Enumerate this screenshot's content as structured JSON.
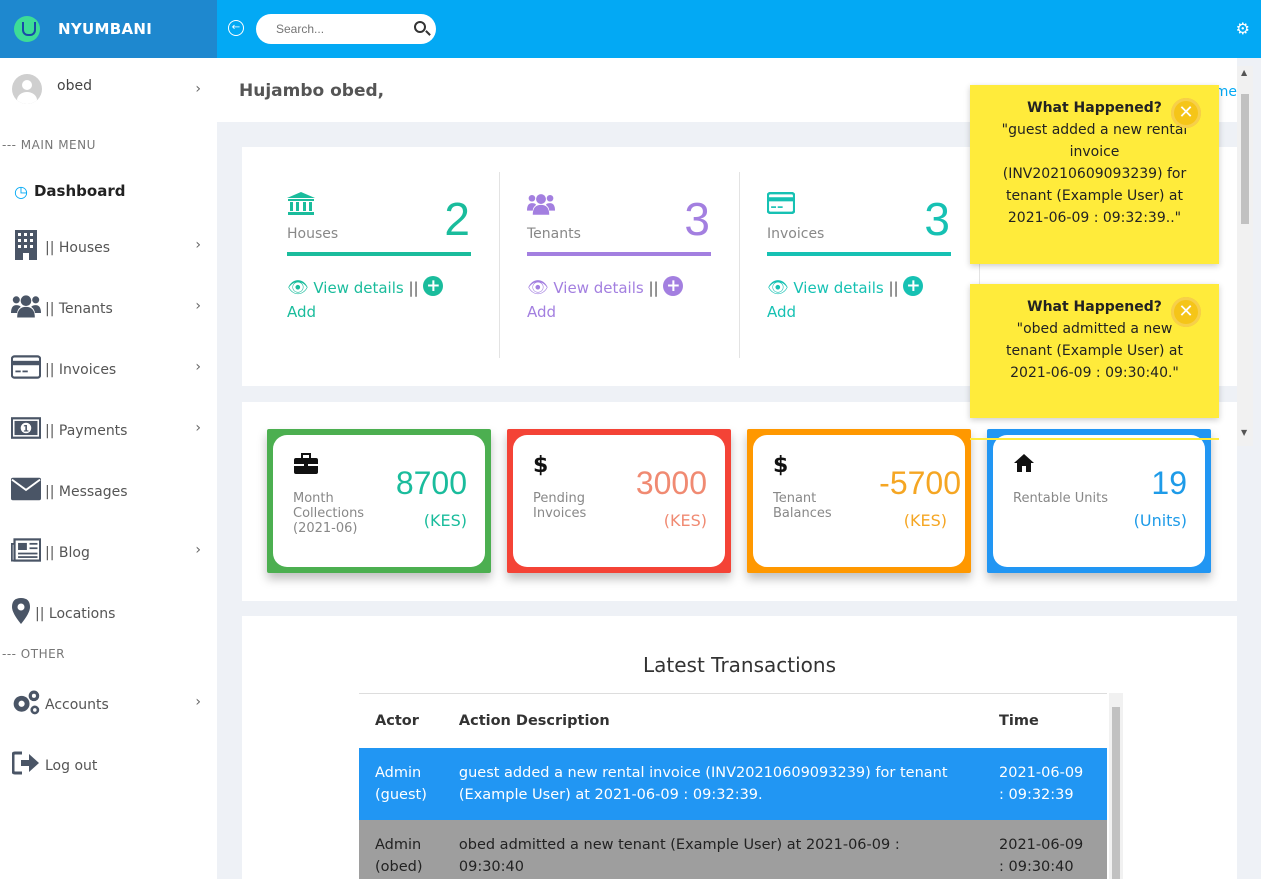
{
  "brand": {
    "name": "NYUMBANI"
  },
  "user": {
    "name": "obed"
  },
  "sidebar": {
    "main_menu_label": "--- MAIN MENU",
    "other_label": "--- OTHER",
    "dashboard": "Dashboard",
    "items": [
      {
        "label": "|| Houses",
        "icon": "building-icon"
      },
      {
        "label": "|| Tenants",
        "icon": "users-icon"
      },
      {
        "label": "|| Invoices",
        "icon": "credit-card-icon"
      },
      {
        "label": "|| Payments",
        "icon": "money-bill-icon"
      },
      {
        "label": "|| Messages",
        "icon": "envelope-icon"
      },
      {
        "label": "|| Blog",
        "icon": "newspaper-icon"
      },
      {
        "label": "|| Locations",
        "icon": "map-marker-icon"
      }
    ],
    "other_items": [
      {
        "label": "Accounts",
        "icon": "cogs-icon"
      },
      {
        "label": "Log out",
        "icon": "sign-out-icon"
      }
    ]
  },
  "topbar": {
    "search_placeholder": "Search..."
  },
  "greeting": {
    "text": "Hujambo obed,",
    "home_link": "me"
  },
  "stats": [
    {
      "label": "Houses",
      "value": "2",
      "color": "#1abc9c",
      "view": "View details",
      "sep": " || ",
      "add": "Add",
      "icon": "bank-icon"
    },
    {
      "label": "Tenants",
      "value": "3",
      "color": "#a37fe0",
      "view": "View details",
      "sep": " || ",
      "add": "Add",
      "icon": "users-icon"
    },
    {
      "label": "Invoices",
      "value": "3",
      "color": "#16c1b3",
      "view": "View details",
      "sep": " || ",
      "add": "Add",
      "icon": "credit-card-icon"
    }
  ],
  "money": [
    {
      "label": "Month Collections (2021-06)",
      "value": "8700",
      "unit": "(KES)",
      "color": "#4caf50",
      "text_color": "#1abc9c",
      "icon": "briefcase-icon"
    },
    {
      "label": "Pending Invoices",
      "value": "3000",
      "unit": "(KES)",
      "color": "#f44336",
      "text_color": "#f08a72",
      "icon": "dollar-icon"
    },
    {
      "label": "Tenant Balances",
      "value": "-5700",
      "unit": "(KES)",
      "color": "#ff9800",
      "text_color": "#f5a623",
      "icon": "dollar-icon"
    },
    {
      "label": "Rentable Units",
      "value": "19",
      "unit": "(Units)",
      "color": "#2196f3",
      "text_color": "#1e9be8",
      "icon": "home-icon"
    }
  ],
  "transactions": {
    "title": "Latest Transactions",
    "headers": [
      "Actor",
      "Action Description",
      "Time"
    ],
    "rows": [
      {
        "actor": "Admin (guest)",
        "desc": "guest added a new rental invoice (INV20210609093239) for tenant (Example User) at 2021-06-09 : 09:32:39.",
        "time": "2021-06-09 : 09:32:39"
      },
      {
        "actor": "Admin (obed)",
        "desc": "obed admitted a new tenant (Example User) at 2021-06-09 : 09:30:40",
        "time": "2021-06-09 : 09:30:40"
      }
    ]
  },
  "toasts": [
    {
      "title": "What Happened?",
      "body": "\"guest added a new rental invoice (INV20210609093239) for tenant (Example User) at 2021-06-09 : 09:32:39..\""
    },
    {
      "title": "What Happened?",
      "body": "\"obed admitted a new tenant (Example User) at 2021-06-09 : 09:30:40.\""
    }
  ]
}
